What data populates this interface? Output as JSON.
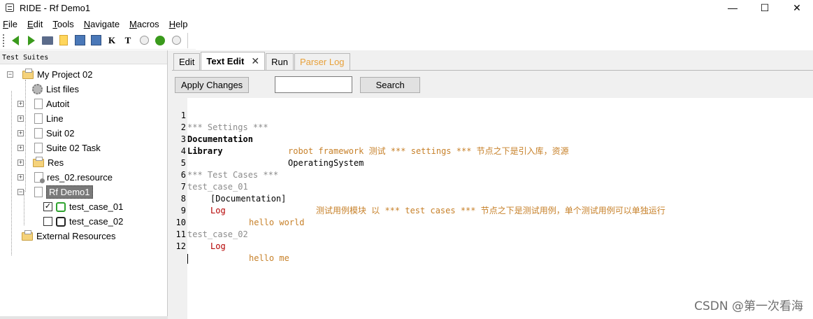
{
  "window": {
    "title": "RIDE - Rf Demo1",
    "controls": {
      "minimize": "—",
      "maximize": "☐",
      "close": "✕"
    }
  },
  "menu": [
    {
      "label": "File",
      "mnemonic": "F",
      "rest": "ile"
    },
    {
      "label": "Edit",
      "mnemonic": "E",
      "rest": "dit"
    },
    {
      "label": "Tools",
      "mnemonic": "T",
      "rest": "ools"
    },
    {
      "label": "Navigate",
      "mnemonic": "N",
      "rest": "avigate"
    },
    {
      "label": "Macros",
      "mnemonic": "M",
      "rest": "acros"
    },
    {
      "label": "Help",
      "mnemonic": "H",
      "rest": "elp"
    }
  ],
  "toolbar": {
    "icons": [
      "back-arrow-icon",
      "forward-arrow-icon",
      "open-folder-icon",
      "new-file-icon",
      "save-icon",
      "save-all-icon",
      "search-keywords-icon",
      "search-tests-icon",
      "run-icon",
      "debug-icon",
      "stop-icon"
    ],
    "keyword_label": "K",
    "tests_label": "T"
  },
  "left_panel": {
    "header": "Test Suites",
    "tree": {
      "root": "My Project 02",
      "list_files": "List files",
      "autoit": "Autoit",
      "line": "Line",
      "suit02": "Suit 02",
      "suite02task": "Suite 02 Task",
      "res": "Res",
      "res02": "res_02.resource",
      "rfdemo1": "Rf Demo1",
      "tc01": "test_case_01",
      "tc02": "test_case_02",
      "external": "External Resources"
    },
    "tc01_checked": "✓"
  },
  "tabs": {
    "edit": "Edit",
    "text_edit": "Text Edit",
    "close": "✕",
    "run": "Run",
    "parser_log": "Parser Log"
  },
  "actions": {
    "apply_changes": "Apply Changes",
    "search_value": "",
    "search": "Search"
  },
  "editor": {
    "lines": {
      "l1": {
        "n": "1",
        "t": "*** Settings ***"
      },
      "l2": {
        "n": "2",
        "k": "Documentation",
        "v": "robot framework 测试 *** settings *** 节点之下是引入库，资源"
      },
      "l3": {
        "n": "3",
        "k": "Library",
        "v": "OperatingSystem"
      },
      "l4": {
        "n": "4"
      },
      "l5": {
        "n": "5",
        "t": "*** Test Cases ***"
      },
      "l6": {
        "n": "6",
        "t": "test_case_01"
      },
      "l7": {
        "n": "7",
        "k": "[Documentation]",
        "v": "测试用例模块 以 *** test cases *** 节点之下是测试用例，单个测试用例可以单独运行"
      },
      "l8": {
        "n": "8",
        "k": "Log",
        "v": "hello world"
      },
      "l9": {
        "n": "9"
      },
      "l10": {
        "n": "10",
        "t": "test_case_02"
      },
      "l11": {
        "n": "11",
        "k": "Log",
        "v": "hello me"
      },
      "l12": {
        "n": "12"
      }
    }
  },
  "watermark": "CSDN @第一次看海"
}
